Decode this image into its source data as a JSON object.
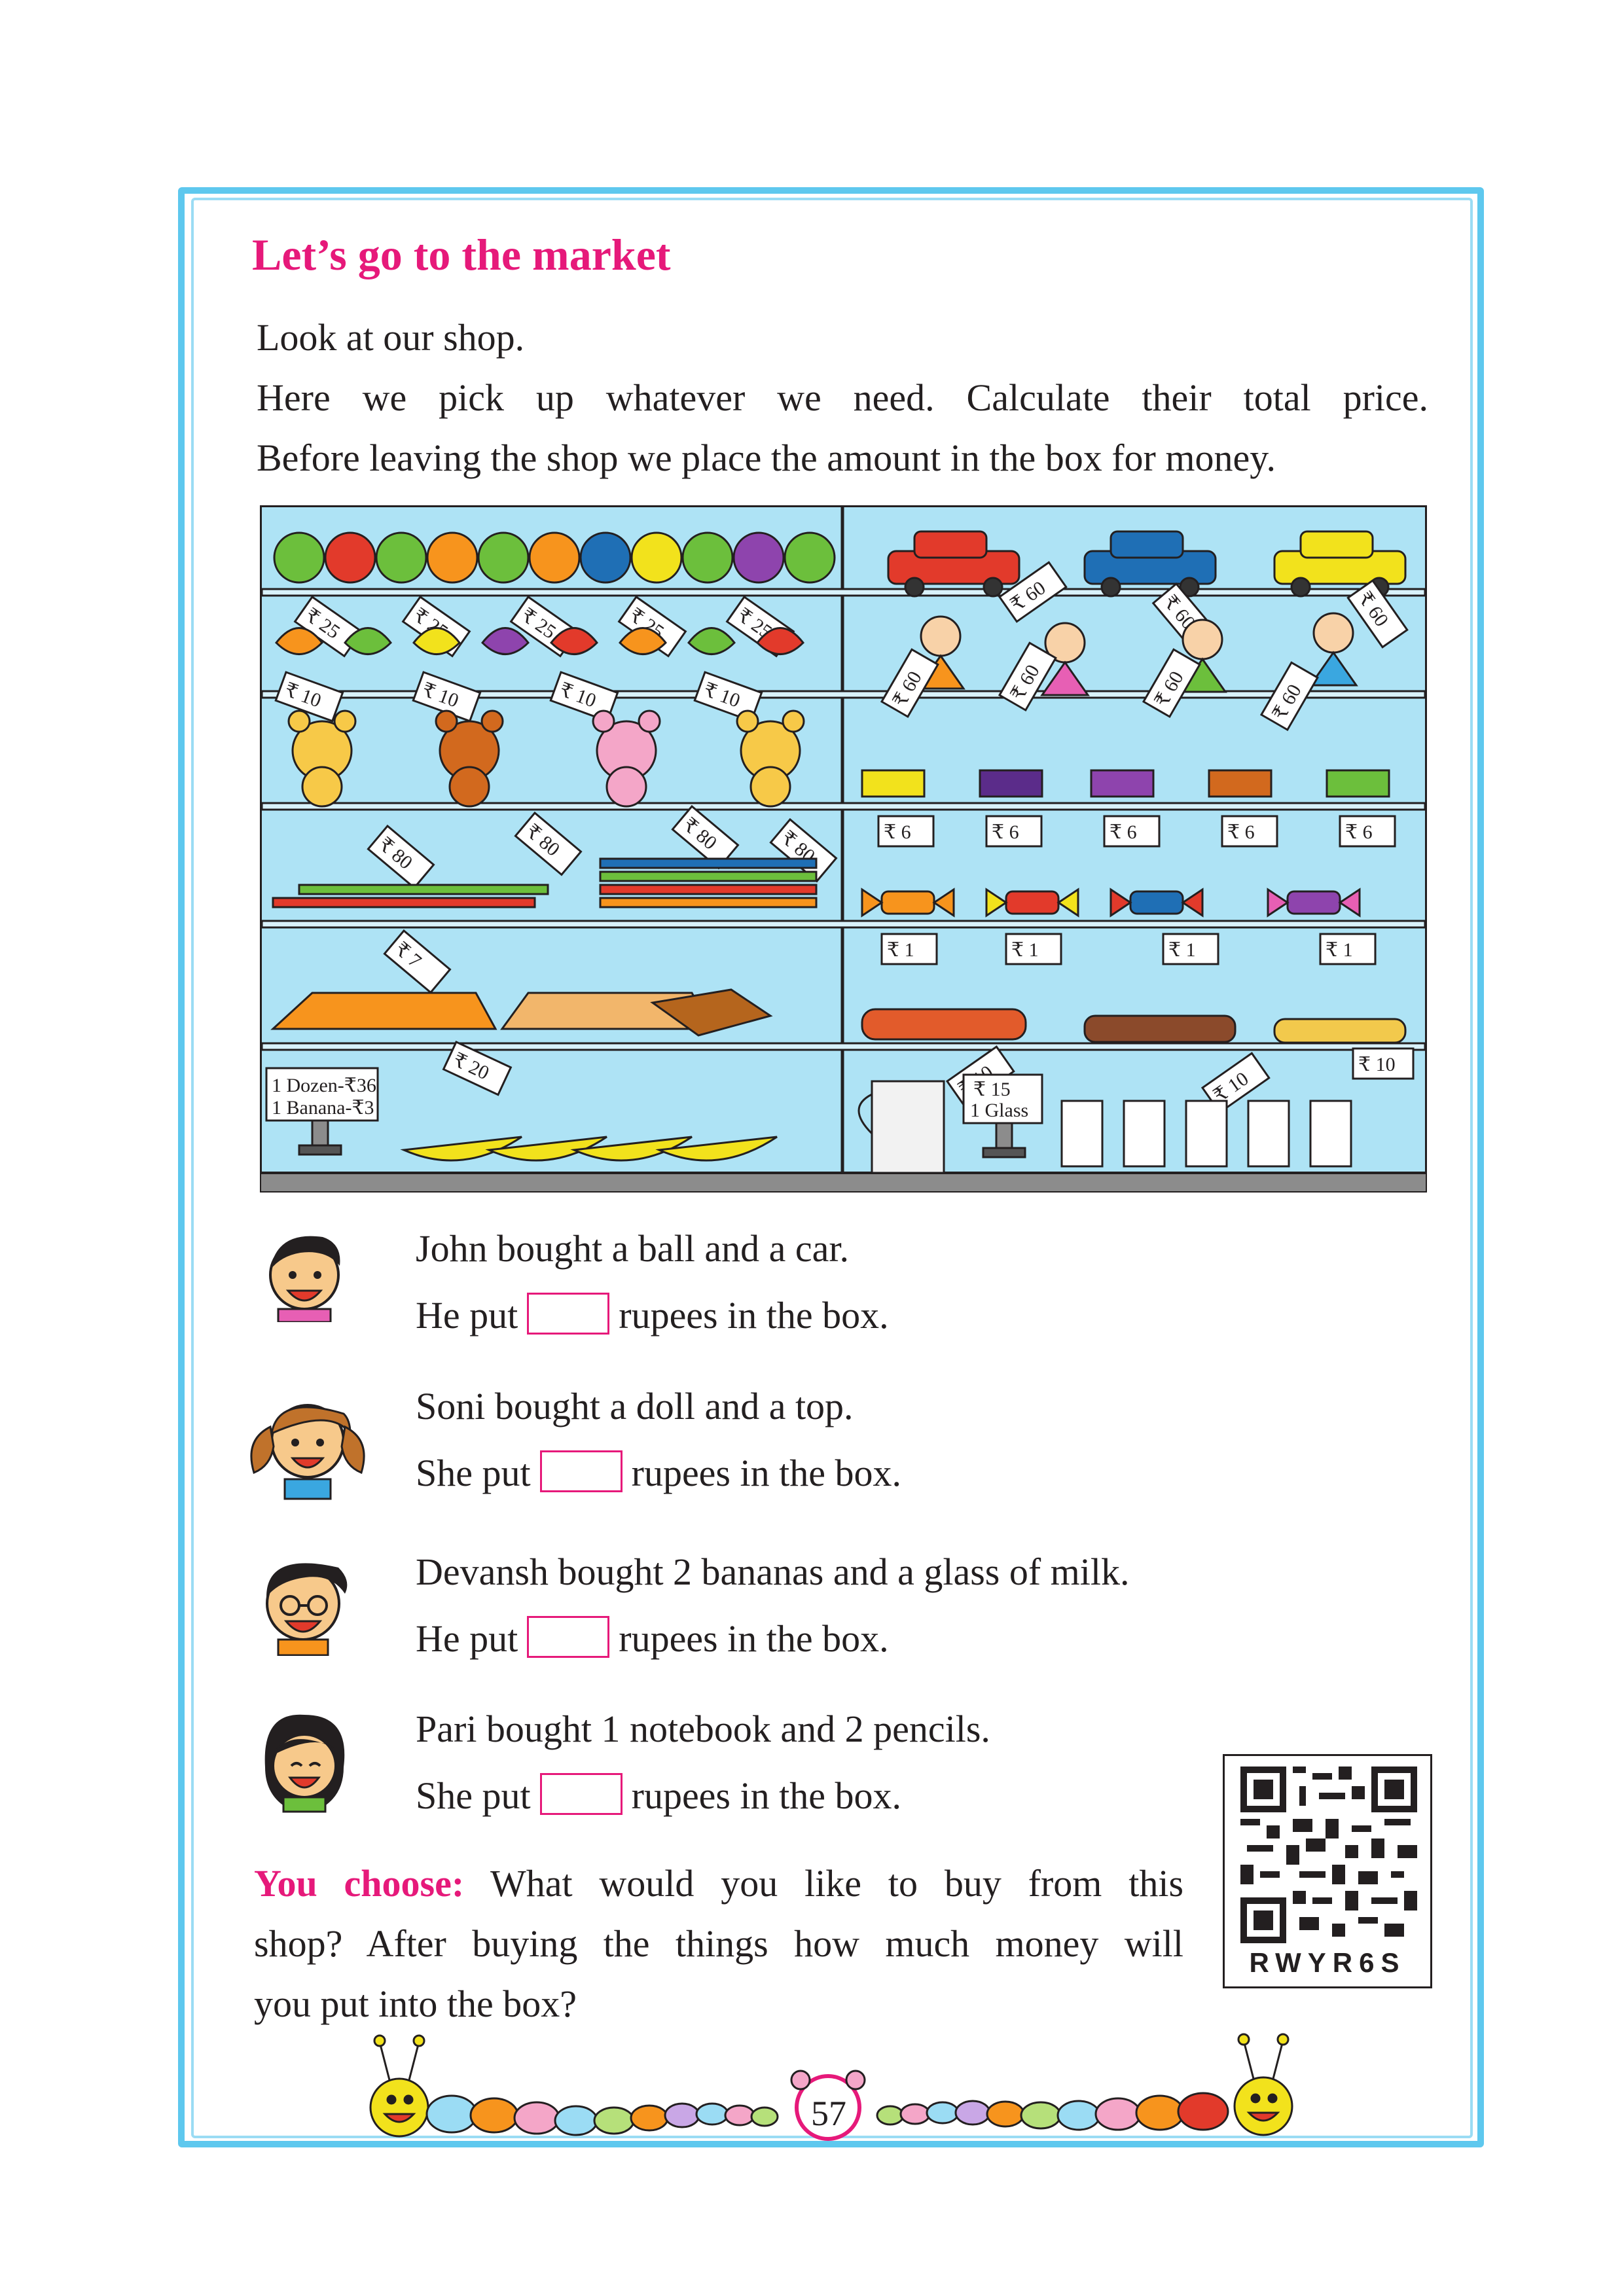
{
  "heading": "Let’s go to the market",
  "intro": [
    "Look at our shop.",
    "Here we pick up whatever we need. Calculate their total price.",
    "Before leaving the shop we place the amount in the box for money."
  ],
  "shop": {
    "price_tags": {
      "ball": "₹ 25",
      "top": "₹ 10",
      "teddy": "₹ 80",
      "pencil": "₹ 7",
      "notebook": "₹ 20",
      "car": "₹ 60",
      "doll": "₹ 60",
      "eraser": "₹ 6",
      "candy": "₹ 1",
      "chocolate": "₹ 10"
    },
    "banana_sign": [
      "1 Dozen-₹36",
      "1 Banana-₹3"
    ],
    "milk_sign": [
      "₹ 15",
      "1 Glass"
    ]
  },
  "questions": [
    {
      "line1": "John bought a ball and a car.",
      "pre": "He put",
      "post": "rupees in the box."
    },
    {
      "line1": "Soni bought a doll and a top.",
      "pre": "She put",
      "post": "rupees in the box."
    },
    {
      "line1": "Devansh bought 2 bananas and a glass of milk.",
      "pre": "He put",
      "post": "rupees in the box."
    },
    {
      "line1": "Pari bought 1 notebook and 2 pencils.",
      "pre": "She put",
      "post": "rupees in the box."
    }
  ],
  "you_choose": {
    "label": "You choose:",
    "lines": [
      "What would you like to buy from this",
      "shop? After buying the things how much money will",
      "you put into the box?"
    ]
  },
  "qr_code_text": "RWYR6S",
  "page_number": "57",
  "colors": {
    "accent": "#e6197a",
    "frame": "#5ec8ee",
    "shelf": "#aee3f5"
  }
}
